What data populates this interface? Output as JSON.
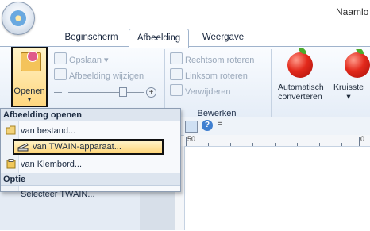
{
  "window": {
    "title": "Naamlo"
  },
  "tabs": [
    {
      "label": "Beginscherm"
    },
    {
      "label": "Afbeelding"
    },
    {
      "label": "Weergave"
    }
  ],
  "ribbon": {
    "open_label": "Openen",
    "open_arrow": "▾",
    "save_label": "Opslaan ▾",
    "edit_image_label": "Afbeelding wijzigen",
    "rotate_right_label": "Rechtsom roteren",
    "rotate_left_label": "Linksom roteren",
    "delete_label": "Verwijderen",
    "edit_group_label": "Bewerken",
    "auto_convert_line1": "Automatisch",
    "auto_convert_line2": "converteren",
    "cross_stitch_label": "Kruisste",
    "cross_stitch_arrow": "▾"
  },
  "menu": {
    "header1": "Afbeelding openen",
    "items": [
      {
        "label": "van bestand..."
      },
      {
        "label": "van TWAIN-apparaat..."
      },
      {
        "label": "van Klembord..."
      }
    ],
    "header2": "Optie",
    "option_item": "Selecteer TWAIN..."
  },
  "toolbar2": {
    "help_glyph": "?",
    "dropdown_glyph": "="
  },
  "ruler": {
    "label_50": "50",
    "label_0": "0"
  },
  "colors": {
    "highlight": "#ffd67a",
    "ribbon_bg": "#e5edf7",
    "accent_border": "#111111"
  }
}
